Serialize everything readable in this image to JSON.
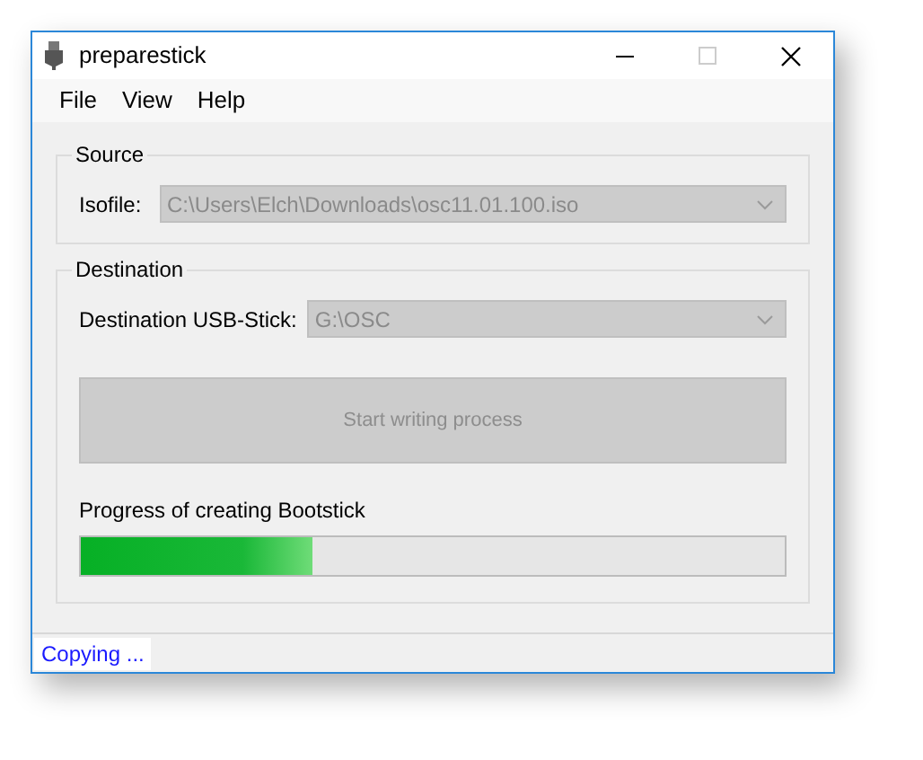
{
  "window": {
    "title": "preparestick"
  },
  "menu": [
    "File",
    "View",
    "Help"
  ],
  "source": {
    "title": "Source",
    "label": "Isofile:",
    "value": "C:\\Users\\Elch\\Downloads\\osc11.01.100.iso",
    "disabled": true
  },
  "destination": {
    "title": "Destination",
    "label": "Destination USB-Stick:",
    "value": "G:\\OSC",
    "disabled": true,
    "button": {
      "label": "Start writing process",
      "disabled": true
    },
    "progress": {
      "label": "Progress of creating Bootstick",
      "level": 0.33
    }
  },
  "status_bar": "Copying ..."
}
